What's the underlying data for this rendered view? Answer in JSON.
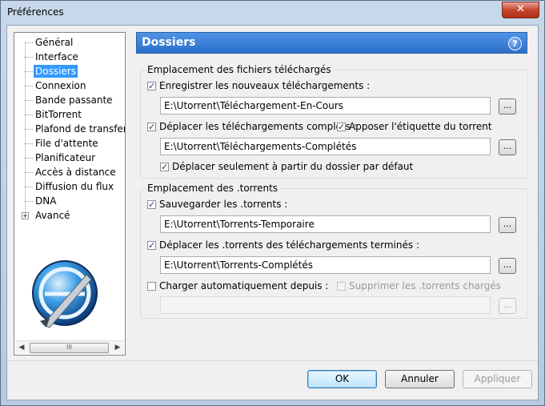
{
  "window": {
    "title": "Préférences",
    "close_label": "✕"
  },
  "tree": {
    "items": [
      {
        "label": "Général"
      },
      {
        "label": "Interface"
      },
      {
        "label": "Dossiers",
        "selected": true
      },
      {
        "label": "Connexion"
      },
      {
        "label": "Bande passante"
      },
      {
        "label": "BitTorrent"
      },
      {
        "label": "Plafond de transfert"
      },
      {
        "label": "File d'attente"
      },
      {
        "label": "Planificateur"
      },
      {
        "label": "Accès à distance"
      },
      {
        "label": "Diffusion du flux"
      },
      {
        "label": "DNA"
      },
      {
        "label": "Avancé",
        "expandable": true
      }
    ],
    "scroll_grip": "III",
    "expander_symbol": "+"
  },
  "header": {
    "title": "Dossiers",
    "help": "?"
  },
  "downloads": {
    "title": "Emplacement des fichiers téléchargés",
    "store_new": {
      "label": "Enregistrer les nouveaux téléchargements :",
      "checked": true,
      "path": "E:\\Utorrent\\Téléchargement-En-Cours"
    },
    "move_completed": {
      "label": "Déplacer les téléchargements complets :",
      "checked": true,
      "path": "E:\\Utorrent\\Téléchargements-Complétés"
    },
    "append_label": {
      "label": "Apposer l'étiquette du torrent",
      "checked": true
    },
    "move_default_only": {
      "label": "Déplacer seulement à partir du dossier par défaut",
      "checked": true
    }
  },
  "torrents": {
    "title": "Emplacement des .torrents",
    "store": {
      "label": "Sauvegarder les .torrents :",
      "checked": true,
      "path": "E:\\Utorrent\\Torrents-Temporaire"
    },
    "move_finished": {
      "label": "Déplacer les .torrents des téléchargements terminés :",
      "checked": true,
      "path": "E:\\Utorrent\\Torrents-Complétés"
    },
    "autoload": {
      "label": "Charger automatiquement depuis :",
      "checked": false,
      "path": ""
    },
    "delete_loaded": {
      "label": "Supprimer les .torrents chargés",
      "checked": false
    }
  },
  "browse_label": "...",
  "buttons": {
    "ok": "OK",
    "cancel": "Annuler",
    "apply": "Appliquer"
  }
}
